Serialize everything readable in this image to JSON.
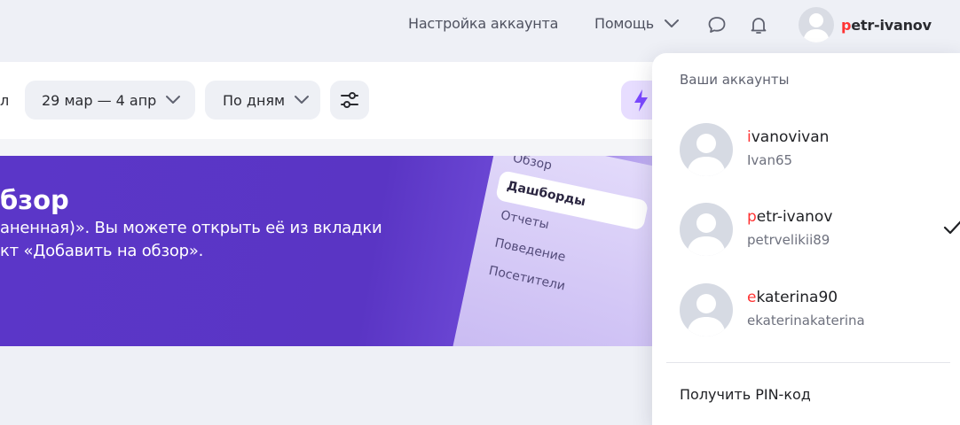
{
  "header": {
    "settings_link": "Настройка аккаунта",
    "help_link": "Помощь",
    "user": {
      "first_letter": "p",
      "rest": "etr-ivanov"
    }
  },
  "toolbar": {
    "left_partial": "л",
    "date_range": "29 мар — 4 апр",
    "grouping": "По дням"
  },
  "banner": {
    "title": "бзор",
    "line1": "аненная)». Вы можете открыть её из вкладки",
    "line2": "кт «Добавить на обзор».",
    "menu": [
      "Обзор",
      "Дашборды",
      "Отчеты",
      "Поведение",
      "Посетители"
    ]
  },
  "accounts_menu": {
    "title": "Ваши аккаунты",
    "accounts": [
      {
        "first": "i",
        "rest": "vanovivan",
        "sub": "Ivan65",
        "selected": false
      },
      {
        "first": "p",
        "rest": "etr-ivanov",
        "sub": "petrvelikii89",
        "selected": true
      },
      {
        "first": "e",
        "rest": "katerina90",
        "sub": "ekaterinakaterina",
        "selected": false
      }
    ],
    "pin_link": "Получить PIN-код"
  },
  "colors": {
    "accent_red": "#ff3333",
    "banner_purple": "#5b36c8",
    "bg": "#eef0f6"
  }
}
